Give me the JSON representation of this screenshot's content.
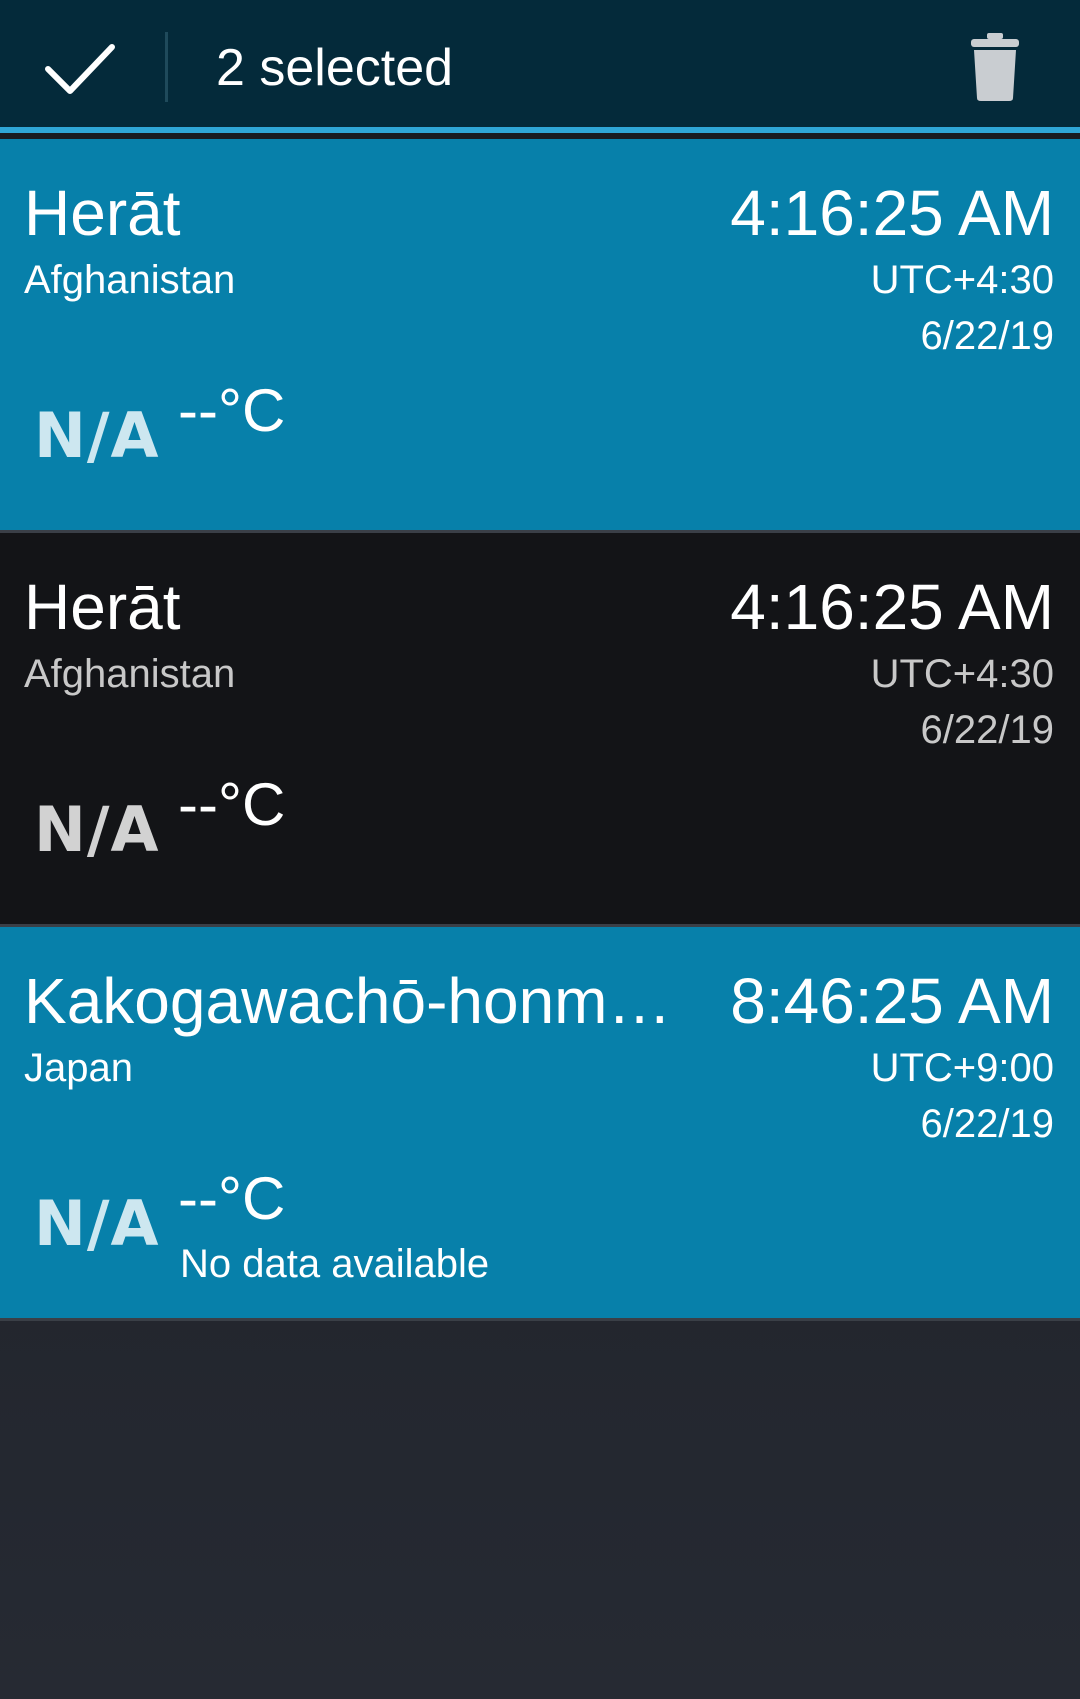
{
  "action_bar": {
    "selection_text": "2 selected",
    "done_icon": "checkmark-icon",
    "delete_icon": "trash-icon",
    "background": "#042a3a",
    "accent": "#2fa6d6"
  },
  "clocks": [
    {
      "city": "Herāt",
      "country": "Afghanistan",
      "time": "4:16:25 AM",
      "utc_offset": "UTC+4:30",
      "date": "6/22/19",
      "weather_icon": "N/A",
      "temperature": "--°C",
      "condition": "",
      "selected": true
    },
    {
      "city": "Herāt",
      "country": "Afghanistan",
      "time": "4:16:25 AM",
      "utc_offset": "UTC+4:30",
      "date": "6/22/19",
      "weather_icon": "N/A",
      "temperature": "--°C",
      "condition": "",
      "selected": false
    },
    {
      "city": "Kakogawachō-honmachi",
      "country": "Japan",
      "time": "8:46:25 AM",
      "utc_offset": "UTC+9:00",
      "date": "6/22/19",
      "weather_icon": "N/A",
      "temperature": "--°C",
      "condition": "No data available",
      "selected": true
    }
  ],
  "colors": {
    "selected_row": "#0780aa",
    "normal_row": "#131417"
  }
}
